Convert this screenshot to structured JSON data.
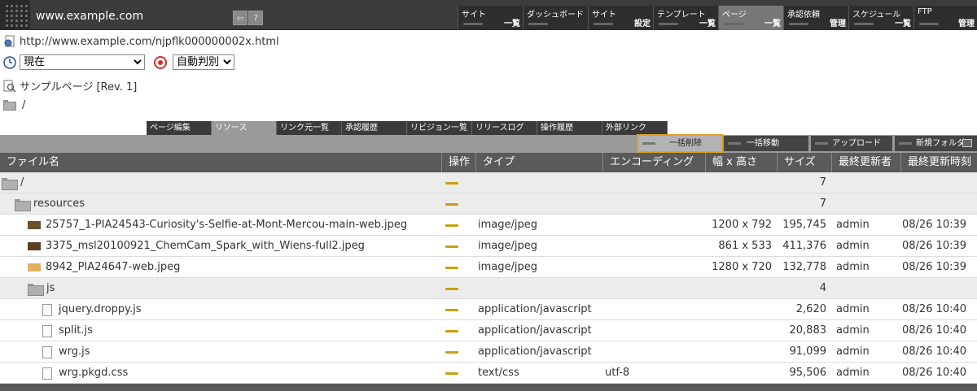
{
  "topbar": {
    "site_url": "www.example.com",
    "icons": [
      "back-icon",
      "help-icon"
    ],
    "help_glyph": "?",
    "back_glyph": "⇦"
  },
  "mainnav": [
    {
      "l1": "サイト",
      "l2": "一覧",
      "w": 80
    },
    {
      "l1": "ダッシュボード",
      "l2": "",
      "w": 80
    },
    {
      "l1": "サイト",
      "l2": "設定",
      "w": 80
    },
    {
      "l1": "テンプレート",
      "l2": "一覧",
      "w": 80
    },
    {
      "l1": "ページ",
      "l2": "一覧",
      "w": 80,
      "active": true
    },
    {
      "l1": "承認依頼",
      "l2": "管理",
      "w": 80
    },
    {
      "l1": "スケジュール",
      "l2": "一覧",
      "w": 80
    },
    {
      "l1": "FTP",
      "l2": "管理",
      "w": 78
    }
  ],
  "info": {
    "page_url": "http://www.example.com/njpflk000000002x.html",
    "time_select": "現在",
    "encoding_select": "自動判別",
    "page_name": "サンプルページ [Rev. 1]",
    "path": "/"
  },
  "tabs": [
    "ページ編集",
    "リソース",
    "リンク元一覧",
    "承認履歴",
    "リビジョン一覧",
    "リリースログ",
    "操作履歴",
    "外部リンク"
  ],
  "active_tab": 1,
  "actions": [
    "一括削除",
    "一括移動",
    "アップロード",
    "新規フォルダ"
  ],
  "table": {
    "headers": [
      "ファイル名",
      "操作",
      "タイプ",
      "エンコーディング",
      "幅 x 高さ",
      "サイズ",
      "最終更新者",
      "最終更新時刻"
    ],
    "rows": [
      {
        "kind": "folder",
        "level": 0,
        "name": "/",
        "type": "",
        "enc": "",
        "dim": "",
        "size": "7",
        "user": "",
        "time": ""
      },
      {
        "kind": "folder",
        "level": 1,
        "name": "resources",
        "type": "",
        "enc": "",
        "dim": "",
        "size": "7",
        "user": "",
        "time": ""
      },
      {
        "kind": "image",
        "level": 2,
        "name": "25757_1-PIA24543-Curiosity's-Selfie-at-Mont-Mercou-main-web.jpeg",
        "type": "image/jpeg",
        "enc": "",
        "dim": "1200 x 792",
        "size": "195,745",
        "user": "admin",
        "time": "08/26 10:39",
        "thumb": "#6b5030"
      },
      {
        "kind": "image",
        "level": 2,
        "name": "3375_msl20100921_ChemCam_Spark_with_Wiens-full2.jpeg",
        "type": "image/jpeg",
        "enc": "",
        "dim": "861 x 533",
        "size": "411,376",
        "user": "admin",
        "time": "08/26 10:39",
        "thumb": "#5a4020"
      },
      {
        "kind": "image",
        "level": 2,
        "name": "8942_PIA24647-web.jpeg",
        "type": "image/jpeg",
        "enc": "",
        "dim": "1280 x 720",
        "size": "132,778",
        "user": "admin",
        "time": "08/26 10:39",
        "thumb": "#e0b060"
      },
      {
        "kind": "folder",
        "level": 2,
        "name": "js",
        "type": "",
        "enc": "",
        "dim": "",
        "size": "4",
        "user": "",
        "time": ""
      },
      {
        "kind": "file",
        "level": 3,
        "name": "jquery.droppy.js",
        "type": "application/javascript",
        "enc": "",
        "dim": "",
        "size": "2,620",
        "user": "admin",
        "time": "08/26 10:40"
      },
      {
        "kind": "file",
        "level": 3,
        "name": "split.js",
        "type": "application/javascript",
        "enc": "",
        "dim": "",
        "size": "20,883",
        "user": "admin",
        "time": "08/26 10:40"
      },
      {
        "kind": "file",
        "level": 3,
        "name": "wrg.js",
        "type": "application/javascript",
        "enc": "",
        "dim": "",
        "size": "91,099",
        "user": "admin",
        "time": "08/26 10:40"
      },
      {
        "kind": "file",
        "level": 3,
        "name": "wrg.pkgd.css",
        "type": "text/css",
        "enc": "utf-8",
        "dim": "",
        "size": "95,506",
        "user": "admin",
        "time": "08/26 10:40"
      }
    ]
  },
  "colors": {
    "accent": "#e0a020",
    "op_bar": "#c8a010",
    "header_bg": "#5a5a5a"
  }
}
